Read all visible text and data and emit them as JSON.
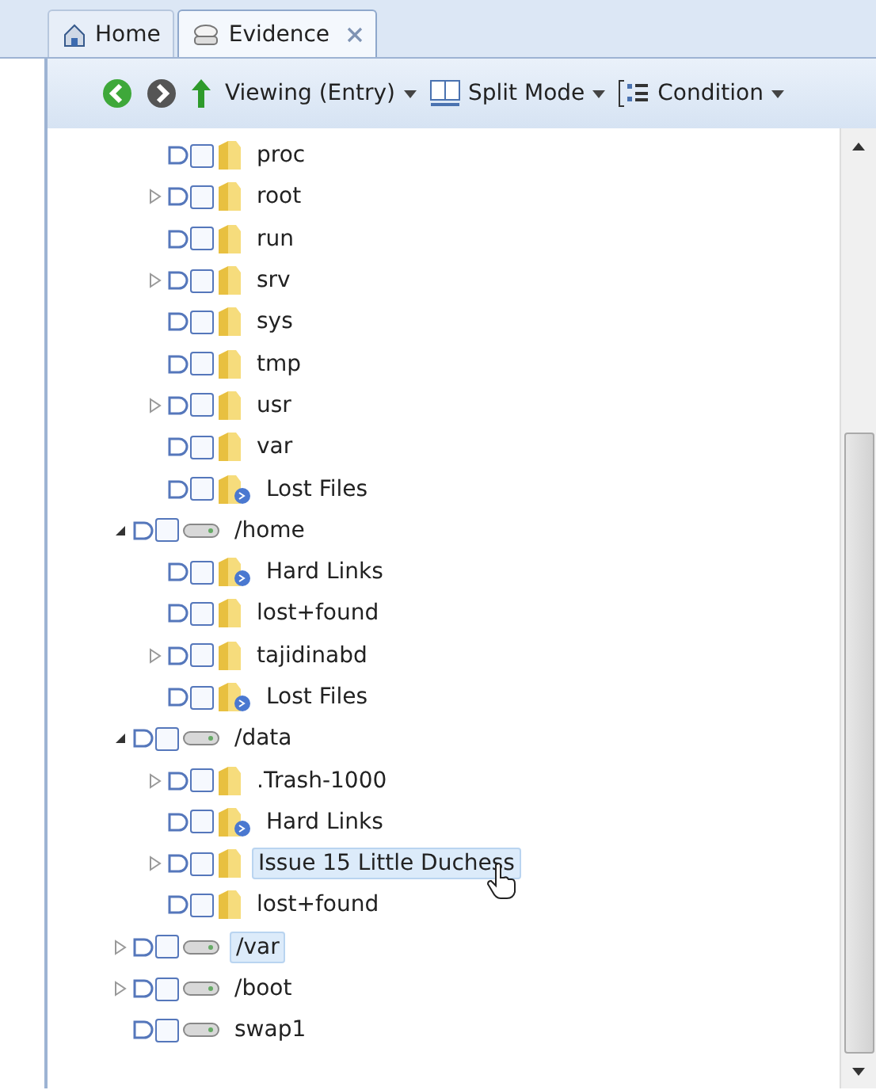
{
  "tabs": [
    {
      "label": "Home",
      "kind": "home",
      "selected": false,
      "closable": false
    },
    {
      "label": "Evidence",
      "kind": "evidence",
      "selected": true,
      "closable": true
    }
  ],
  "toolbar": {
    "items": [
      {
        "kind": "back"
      },
      {
        "kind": "forward"
      },
      {
        "kind": "up"
      },
      {
        "kind": "dropdown",
        "label": "Viewing (Entry)"
      },
      {
        "kind": "split",
        "label": "Split Mode"
      },
      {
        "kind": "condition",
        "label": "Condition"
      }
    ]
  },
  "tree": {
    "items": [
      {
        "children": [
          {
            "label": "proc",
            "kind": "folder",
            "expandable": false,
            "expanded": false,
            "checked": false,
            "highlighted": false,
            "cursor": false
          },
          {
            "label": "root",
            "kind": "folder",
            "expandable": true,
            "expanded": false,
            "checked": false,
            "highlighted": false,
            "cursor": false
          },
          {
            "label": "run",
            "kind": "folder",
            "expandable": false,
            "expanded": false,
            "checked": false,
            "highlighted": false,
            "cursor": false
          },
          {
            "label": "srv",
            "kind": "folder",
            "expandable": true,
            "expanded": false,
            "checked": false,
            "highlighted": false,
            "cursor": false
          },
          {
            "label": "sys",
            "kind": "folder",
            "expandable": false,
            "expanded": false,
            "checked": false,
            "highlighted": false,
            "cursor": false
          },
          {
            "label": "tmp",
            "kind": "folder",
            "expandable": false,
            "expanded": false,
            "checked": false,
            "highlighted": false,
            "cursor": false
          },
          {
            "label": "usr",
            "kind": "folder",
            "expandable": true,
            "expanded": false,
            "checked": false,
            "highlighted": false,
            "cursor": false
          },
          {
            "label": "var",
            "kind": "folder",
            "expandable": false,
            "expanded": false,
            "checked": false,
            "highlighted": false,
            "cursor": false
          },
          {
            "label": "Lost Files",
            "kind": "linked",
            "expandable": false,
            "expanded": false,
            "checked": false,
            "highlighted": false,
            "cursor": false
          }
        ]
      },
      {
        "label": "/home",
        "kind": "drive",
        "expandable": true,
        "expanded": true,
        "checked": false,
        "highlighted": false,
        "cursor": false,
        "children": [
          {
            "label": "Hard Links",
            "kind": "linked",
            "expandable": false,
            "expanded": false,
            "checked": false,
            "highlighted": false,
            "cursor": false
          },
          {
            "label": "lost+found",
            "kind": "folder",
            "expandable": false,
            "expanded": false,
            "checked": false,
            "highlighted": false,
            "cursor": false
          },
          {
            "label": "tajidinabd",
            "kind": "folder",
            "expandable": true,
            "expanded": false,
            "checked": false,
            "highlighted": false,
            "cursor": false
          },
          {
            "label": "Lost Files",
            "kind": "linked",
            "expandable": false,
            "expanded": false,
            "checked": false,
            "highlighted": false,
            "cursor": false
          }
        ]
      },
      {
        "label": "/data",
        "kind": "drive",
        "expandable": true,
        "expanded": true,
        "checked": false,
        "highlighted": false,
        "cursor": false,
        "children": [
          {
            "label": ".Trash-1000",
            "kind": "folder",
            "expandable": true,
            "expanded": false,
            "checked": false,
            "highlighted": false,
            "cursor": false
          },
          {
            "label": "Hard Links",
            "kind": "linked",
            "expandable": false,
            "expanded": false,
            "checked": false,
            "highlighted": false,
            "cursor": false
          },
          {
            "label": "Issue 15 Little Duchess",
            "kind": "folder",
            "expandable": true,
            "expanded": false,
            "checked": false,
            "highlighted": true,
            "cursor": true
          },
          {
            "label": "lost+found",
            "kind": "folder",
            "expandable": false,
            "expanded": false,
            "checked": false,
            "highlighted": false,
            "cursor": false
          }
        ]
      },
      {
        "label": "/var",
        "kind": "drive",
        "expandable": true,
        "expanded": false,
        "checked": false,
        "highlighted": true,
        "cursor": false
      },
      {
        "label": "/boot",
        "kind": "drive",
        "expandable": true,
        "expanded": false,
        "checked": false,
        "highlighted": false,
        "cursor": false
      },
      {
        "label": "swap1",
        "kind": "drive",
        "expandable": false,
        "expanded": false,
        "checked": false,
        "highlighted": false,
        "cursor": false
      }
    ]
  }
}
